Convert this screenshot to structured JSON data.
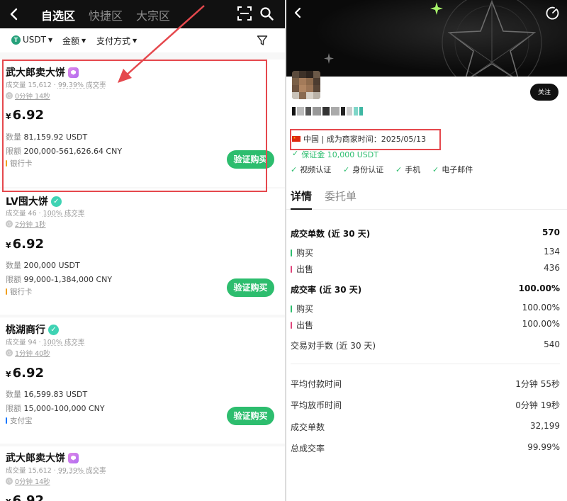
{
  "left": {
    "header": {
      "tabs": [
        {
          "label": "自选区",
          "active": true
        },
        {
          "label": "快捷区",
          "active": false
        },
        {
          "label": "大宗区",
          "active": false
        }
      ]
    },
    "filters": {
      "coin": "USDT",
      "amount": "金额",
      "payment": "支付方式"
    },
    "ads": [
      {
        "merchant": "武大郎卖大饼",
        "badge": "purple",
        "volume": "成交量 15,612",
        "rate": "99.39% 成交率",
        "time": "0分钟 14秒",
        "currency": "¥",
        "price": "6.92",
        "qty_label": "数量",
        "qty": "81,159.92 USDT",
        "limit_label": "限额",
        "limit": "200,000-561,626.64 CNY",
        "pay": "银行卡",
        "pay_color": "#f0a020",
        "button": "验证购买"
      },
      {
        "merchant": "LV囤大饼",
        "badge": "green",
        "volume": "成交量 46",
        "rate": "100% 成交率",
        "time": "2分钟 1秒",
        "currency": "¥",
        "price": "6.92",
        "qty_label": "数量",
        "qty": "200,000 USDT",
        "limit_label": "限额",
        "limit": "99,000-1,384,000 CNY",
        "pay": "银行卡",
        "pay_color": "#f0a020",
        "button": "验证购买"
      },
      {
        "merchant": "桃湖商行",
        "badge": "green",
        "volume": "成交量 94",
        "rate": "100% 成交率",
        "time": "1分钟 40秒",
        "currency": "¥",
        "price": "6.92",
        "qty_label": "数量",
        "qty": "16,599.83 USDT",
        "limit_label": "限额",
        "limit": "15,000-100,000 CNY",
        "pay": "支付宝",
        "pay_color": "#1677ff",
        "button": "验证购买"
      },
      {
        "merchant": "武大郎卖大饼",
        "badge": "purple",
        "volume": "成交量 15,612",
        "rate": "99.39% 成交率",
        "time": "0分钟 14秒",
        "currency": "¥",
        "price": "6.92"
      }
    ]
  },
  "right": {
    "follow": "关注",
    "country_info": "中国 | 成为商家时间：2025/05/13",
    "deposit": "保证金 10,000 USDT",
    "verifications": [
      "视频认证",
      "身份认证",
      "手机",
      "电子邮件"
    ],
    "tabs": [
      {
        "label": "详情",
        "active": true
      },
      {
        "label": "委托单",
        "active": false
      }
    ],
    "stats": {
      "orders30_label": "成交单数 (近 30 天)",
      "orders30": "570",
      "buy_label": "购买",
      "buy": "134",
      "sell_label": "出售",
      "sell": "436",
      "rate30_label": "成交率 (近 30 天)",
      "rate30": "100.00%",
      "buy_rate": "100.00%",
      "sell_rate": "100.00%",
      "counterparties_label": "交易对手数 (近 30 天)",
      "counterparties": "540",
      "avg_pay_label": "平均付款时间",
      "avg_pay": "1分钟 55秒",
      "avg_release_label": "平均放币时间",
      "avg_release": "0分钟 19秒",
      "total_orders_label": "成交单数",
      "total_orders": "32,199",
      "total_rate_label": "总成交率",
      "total_rate": "99.99%"
    },
    "colors": {
      "buy": "#2dbd6e",
      "sell": "#e0457b",
      "accent": "#2dbd6e"
    }
  }
}
